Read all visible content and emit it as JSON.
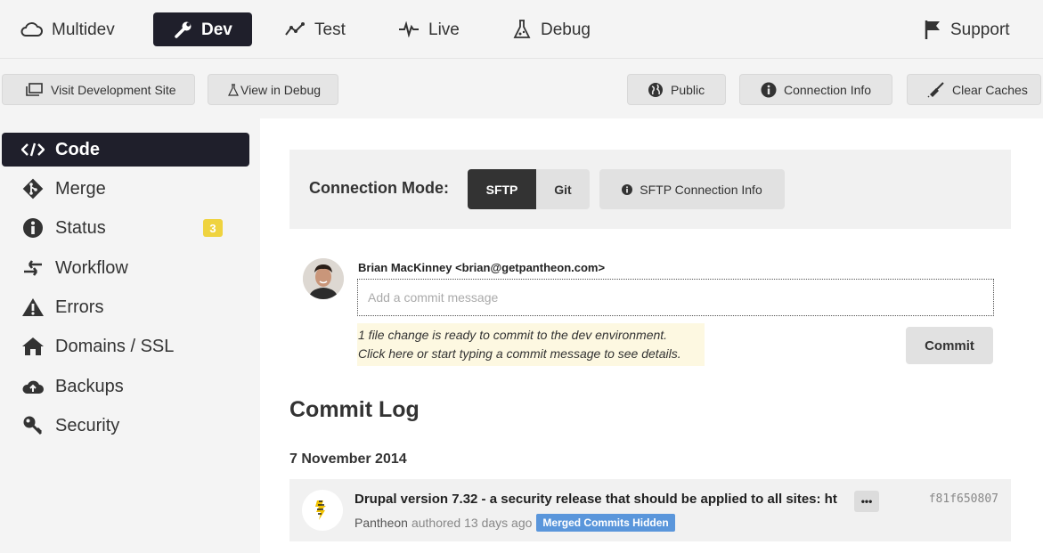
{
  "topnav": {
    "tabs": [
      {
        "label": "Multidev",
        "icon": "cloud-icon"
      },
      {
        "label": "Dev",
        "icon": "wrench-icon",
        "active": true
      },
      {
        "label": "Test",
        "icon": "chart-line-icon"
      },
      {
        "label": "Live",
        "icon": "pulse-icon"
      },
      {
        "label": "Debug",
        "icon": "flask-icon"
      }
    ],
    "support_label": "Support"
  },
  "actions": {
    "visit_site": "Visit Development Site",
    "view_debug": "View in Debug",
    "public": "Public",
    "connection_info": "Connection Info",
    "clear_caches": "Clear Caches"
  },
  "sidebar": {
    "items": [
      {
        "label": "Code",
        "icon": "code-icon",
        "active": true
      },
      {
        "label": "Merge",
        "icon": "git-merge-icon"
      },
      {
        "label": "Status",
        "icon": "info-icon",
        "badge": "3"
      },
      {
        "label": "Workflow",
        "icon": "arrows-icon"
      },
      {
        "label": "Errors",
        "icon": "warning-icon"
      },
      {
        "label": "Domains / SSL",
        "icon": "home-icon"
      },
      {
        "label": "Backups",
        "icon": "cloud-upload-icon"
      },
      {
        "label": "Security",
        "icon": "key-icon"
      }
    ]
  },
  "connection": {
    "label": "Connection Mode:",
    "modes": [
      "SFTP",
      "Git"
    ],
    "active_mode": "SFTP",
    "info_label": "SFTP Connection Info"
  },
  "commit_form": {
    "author": "Brian MacKinney <brian@getpantheon.com>",
    "placeholder": "Add a commit message",
    "notice_line1": "1 file change is ready to commit to the dev environment.",
    "notice_line2": "Click here or start typing a commit message to see details.",
    "commit_button": "Commit"
  },
  "commit_log": {
    "title": "Commit Log",
    "date": "7 November 2014",
    "commits": [
      {
        "message": "Drupal version 7.32 - a security release that should be applied to all sites: ht",
        "author": "Pantheon",
        "meta": "authored 13 days ago",
        "badge": "Merged Commits Hidden",
        "more": "•••",
        "hash": "f81f650807"
      }
    ]
  },
  "colors": {
    "active_bg": "#1f1f2b",
    "badge_yellow": "#efd33f",
    "merged_blue": "#5a96db",
    "notice_bg": "#fdf8e1"
  }
}
